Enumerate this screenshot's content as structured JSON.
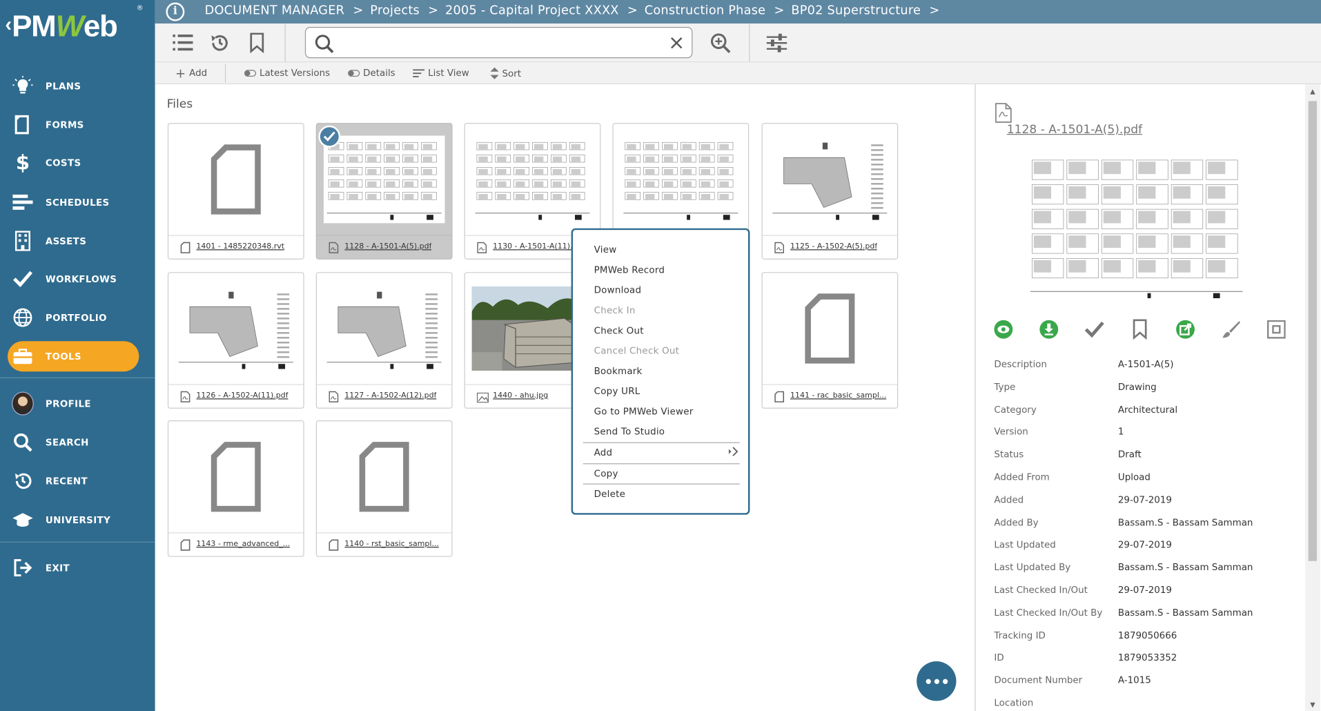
{
  "app": {
    "logo_text": "PMWeb",
    "logo_reg": "®"
  },
  "breadcrumb": [
    "DOCUMENT MANAGER",
    "Projects",
    "2005 - Capital Project XXXX",
    "Construction Phase",
    "BP02 Superstructure"
  ],
  "breadcrumb_separator": ">",
  "sidebar": {
    "items": [
      {
        "label": "PLANS",
        "icon": "lightbulb-icon"
      },
      {
        "label": "FORMS",
        "icon": "document-icon"
      },
      {
        "label": "COSTS",
        "icon": "dollar-icon"
      },
      {
        "label": "SCHEDULES",
        "icon": "schedule-bars-icon"
      },
      {
        "label": "ASSETS",
        "icon": "building-icon"
      },
      {
        "label": "WORKFLOWS",
        "icon": "checkmark-icon"
      },
      {
        "label": "PORTFOLIO",
        "icon": "globe-icon"
      },
      {
        "label": "TOOLS",
        "icon": "briefcase-icon",
        "active": true
      },
      {
        "label": "PROFILE",
        "icon": "avatar"
      },
      {
        "label": "SEARCH",
        "icon": "search-icon"
      },
      {
        "label": "RECENT",
        "icon": "history-icon"
      },
      {
        "label": "UNIVERSITY",
        "icon": "graduation-cap-icon"
      },
      {
        "label": "EXIT",
        "icon": "exit-icon"
      }
    ],
    "active_color": "#f5a623",
    "bg_color": "#2f6b8e"
  },
  "search": {
    "value": "",
    "placeholder": ""
  },
  "subbar": {
    "add": "Add",
    "latest_versions": "Latest Versions",
    "details": "Details",
    "list_view": "List View",
    "sort": "Sort"
  },
  "files_title": "Files",
  "files": [
    {
      "name": "1401 - 1485220348.rvt",
      "kind": "blank"
    },
    {
      "name": "1128 - A-1501-A(5).pdf",
      "kind": "drawing",
      "selected": true
    },
    {
      "name": "1130 - A-1501-A(11).pdf",
      "kind": "drawing"
    },
    {
      "name": "",
      "kind": "drawing"
    },
    {
      "name": "1125 - A-1502-A(5).pdf",
      "kind": "plan"
    },
    {
      "name": "1126 - A-1502-A(11).pdf",
      "kind": "plan"
    },
    {
      "name": "1127 - A-1502-A(12).pdf",
      "kind": "plan"
    },
    {
      "name": "1440 - ahu.jpg",
      "kind": "photo"
    },
    {
      "name": "",
      "kind": "hidden"
    },
    {
      "name": "1141 - rac_basic_sampl...",
      "kind": "blank"
    },
    {
      "name": "1143 - rme_advanced_...",
      "kind": "blank"
    },
    {
      "name": "1140 - rst_basic_sampl...",
      "kind": "blank"
    }
  ],
  "context_menu": {
    "items": [
      {
        "label": "View",
        "disabled": false
      },
      {
        "label": "PMWeb Record",
        "disabled": false
      },
      {
        "label": "Download",
        "disabled": false
      },
      {
        "label": "Check In",
        "disabled": true
      },
      {
        "label": "Check Out",
        "disabled": false
      },
      {
        "label": "Cancel Check Out",
        "disabled": true
      },
      {
        "label": "Bookmark",
        "disabled": false
      },
      {
        "label": "Copy URL",
        "disabled": false
      },
      {
        "label": "Go to PMWeb Viewer",
        "disabled": false
      },
      {
        "label": "Send To Studio",
        "disabled": false
      },
      {
        "label": "Add",
        "disabled": false,
        "submenu": true
      },
      {
        "label": "Copy",
        "disabled": false
      },
      {
        "label": "Delete",
        "disabled": false
      }
    ]
  },
  "detail": {
    "filename": "1128 - A-1501-A(5).pdf",
    "actions": [
      "view-icon",
      "download-icon",
      "check-icon",
      "bookmark-icon",
      "open-external-icon",
      "markup-brush-icon",
      "crop-icon"
    ],
    "properties": [
      {
        "key": "Description",
        "value": "A-1501-A(5)"
      },
      {
        "key": "Type",
        "value": "Drawing"
      },
      {
        "key": "Category",
        "value": "Architectural"
      },
      {
        "key": "Version",
        "value": "1"
      },
      {
        "key": "Status",
        "value": "Draft"
      },
      {
        "key": "Added From",
        "value": "Upload"
      },
      {
        "key": "Added",
        "value": "29-07-2019"
      },
      {
        "key": "Added By",
        "value": "Bassam.S - Bassam Samman"
      },
      {
        "key": "Last Updated",
        "value": "29-07-2019"
      },
      {
        "key": "Last Updated By",
        "value": "Bassam.S - Bassam Samman"
      },
      {
        "key": "Last Checked In/Out",
        "value": "29-07-2019"
      },
      {
        "key": "Last Checked In/Out By",
        "value": "Bassam.S - Bassam Samman"
      },
      {
        "key": "Tracking ID",
        "value": "1879050666"
      },
      {
        "key": "ID",
        "value": "1879053352"
      },
      {
        "key": "Document Number",
        "value": "A-1015"
      },
      {
        "key": "Location",
        "value": ""
      }
    ]
  },
  "colors": {
    "topbar": "#5e87a2",
    "accent_green": "#3aa84a",
    "menu_border": "#2f6b8e"
  }
}
